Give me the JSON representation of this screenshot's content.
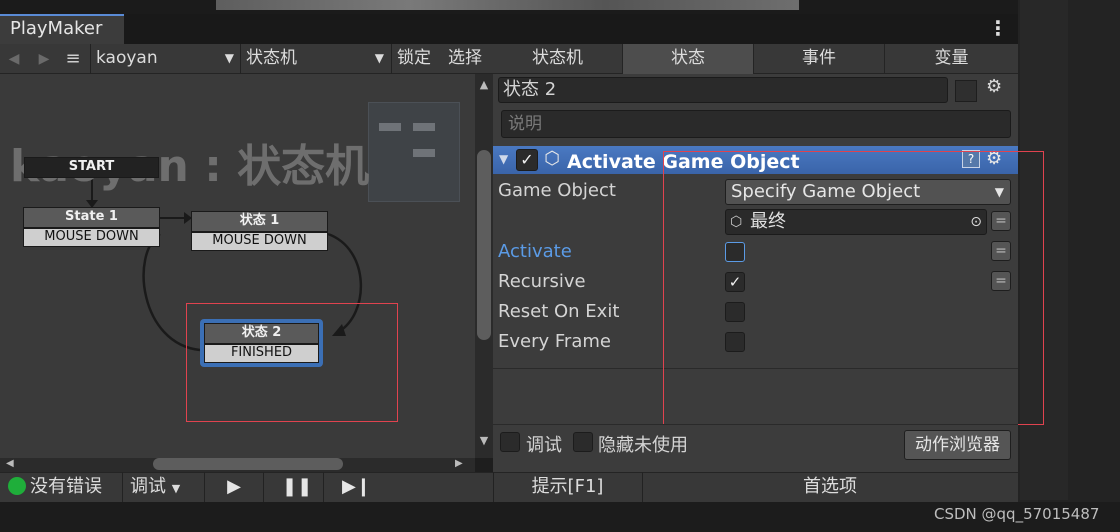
{
  "window": {
    "tab_title": "PlayMaker"
  },
  "toolbar": {
    "fsm_owner": "kaoyan",
    "fsm_name": "状态机",
    "lock_label": "锁定",
    "select_label": "选择"
  },
  "inspector_tabs": [
    "状态机",
    "状态",
    "事件",
    "变量"
  ],
  "canvas": {
    "watermark": "kaoyan : 状态机",
    "nodes": [
      {
        "title": "START",
        "event": ""
      },
      {
        "title": "State 1",
        "event": "MOUSE DOWN"
      },
      {
        "title": "状态 1",
        "event": "MOUSE DOWN"
      },
      {
        "title": "状态 2",
        "event": "FINISHED"
      }
    ]
  },
  "state": {
    "name": "状态 2",
    "description_placeholder": "说明"
  },
  "action": {
    "title": "Activate Game Object",
    "enabled": true,
    "fields": {
      "game_object_label": "Game Object",
      "game_object_mode": "Specify Game Object",
      "game_object_value": "最终",
      "activate_label": "Activate",
      "recursive_label": "Recursive",
      "reset_on_exit_label": "Reset On Exit",
      "every_frame_label": "Every Frame"
    },
    "values": {
      "activate": false,
      "recursive": true,
      "reset_on_exit": false,
      "every_frame": false
    }
  },
  "inspector_footer": {
    "debug_label": "调试",
    "hide_unused_label": "隐藏未使用",
    "action_browser_label": "动作浏览器"
  },
  "bottom_bar": {
    "status_text": "没有错误",
    "debug_menu": "调试",
    "hint_label": "提示[F1]",
    "preferences_label": "首选项"
  },
  "statusbar": {
    "watermark": "CSDN @qq_57015487"
  },
  "colors": {
    "accent_blue": "#3b6fb5",
    "link_blue": "#5b9be6",
    "ok_green": "#1fae3a",
    "highlight_red": "#e0434f"
  }
}
